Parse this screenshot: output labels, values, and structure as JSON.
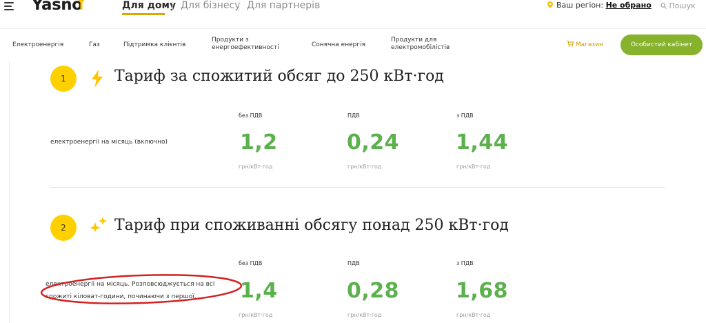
{
  "header": {
    "logo": "Yasno",
    "tabs": [
      {
        "label": "Для дому",
        "active": true
      },
      {
        "label": "Для бізнесу",
        "active": false
      },
      {
        "label": "Для партнерів",
        "active": false
      }
    ],
    "region_prefix": "Ваш регіон:",
    "region_value": "Не обрано",
    "search_placeholder": "Пошук"
  },
  "nav": {
    "items": [
      "Електроенергія",
      "Газ",
      "Підтримка клієнтів",
      "Продукти з енергоефективності",
      "Сонячна енергія",
      "Продукти для електромобілістів"
    ],
    "shop": "Магазин",
    "cabinet": "Особистий кабінет"
  },
  "tariffs": [
    {
      "number": "1",
      "title": "Тариф за спожитий обсяг до 250 кВт·год",
      "label": "електроенергії на місяць (включно)",
      "columns": [
        "без ПДВ",
        "ПДВ",
        "з ПДВ"
      ],
      "values": [
        "1,2",
        "0,24",
        "1,44"
      ],
      "unit": "грн/кВт·год"
    },
    {
      "number": "2",
      "title": "Тариф при споживанні обсягу понад 250 кВт·год",
      "label_line1": "електроенергії на місяць. Розповсюджується на всі",
      "label_line2": "спожиті кіловат-години, починаючи з першої.",
      "columns": [
        "без ПДВ",
        "ПДВ",
        "з ПДВ"
      ],
      "values": [
        "1,4",
        "0,28",
        "1,68"
      ],
      "unit": "грн/кВт·год"
    }
  ],
  "colors": {
    "accent_green": "#5cb04d",
    "badge_yellow": "#ffd000",
    "cabinet_green": "#86b22c",
    "annotation_red": "#d42020"
  }
}
